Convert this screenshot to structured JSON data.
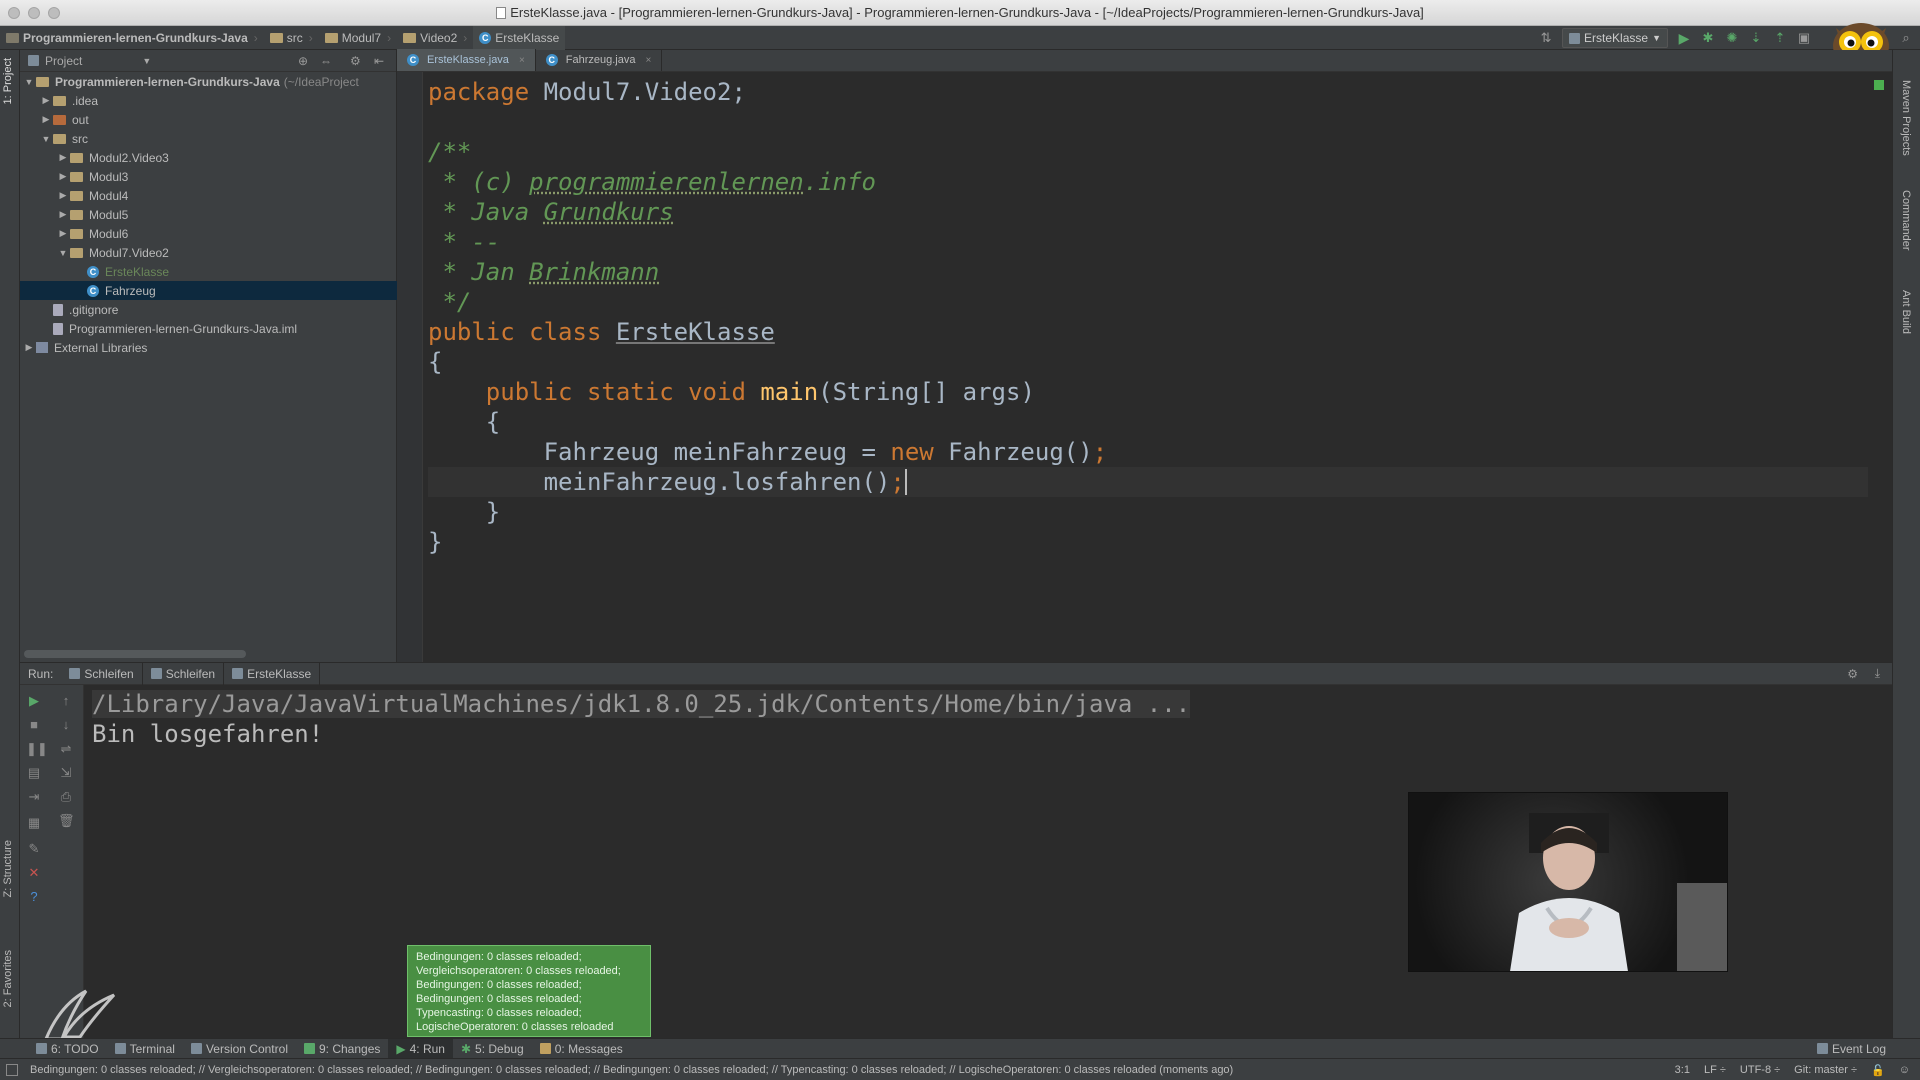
{
  "window": {
    "title": "ErsteKlasse.java - [Programmieren-lernen-Grundkurs-Java] - Programmieren-lernen-Grundkurs-Java - [~/IdeaProjects/Programmieren-lernen-Grundkurs-Java]"
  },
  "navbar": {
    "crumbs": [
      "Programmieren-lernen-Grundkurs-Java",
      "src",
      "Modul7",
      "Video2",
      "ErsteKlasse"
    ],
    "run_config": "ErsteKlasse"
  },
  "left_strip": {
    "project_tab": "1: Project",
    "structure_tab": "Z: Structure",
    "favorites_tab": "2: Favorites"
  },
  "right_strip": {
    "maven_tab": "Maven Projects",
    "commander_tab": "Commander",
    "ant_tab": "Ant Build"
  },
  "project": {
    "header": "Project",
    "tree": [
      {
        "label": "Programmieren-lernen-Grundkurs-Java",
        "suffix": "(~/IdeaProject",
        "level": 0,
        "arrow": "▼",
        "icon": "folder",
        "bold": true
      },
      {
        "label": ".idea",
        "level": 1,
        "arrow": "▶",
        "icon": "folder"
      },
      {
        "label": "out",
        "level": 1,
        "arrow": "▶",
        "icon": "folder-red"
      },
      {
        "label": "src",
        "level": 1,
        "arrow": "▼",
        "icon": "folder"
      },
      {
        "label": "Modul2.Video3",
        "level": 2,
        "arrow": "▶",
        "icon": "folder"
      },
      {
        "label": "Modul3",
        "level": 2,
        "arrow": "▶",
        "icon": "folder"
      },
      {
        "label": "Modul4",
        "level": 2,
        "arrow": "▶",
        "icon": "folder"
      },
      {
        "label": "Modul5",
        "level": 2,
        "arrow": "▶",
        "icon": "folder"
      },
      {
        "label": "Modul6",
        "level": 2,
        "arrow": "▶",
        "icon": "folder"
      },
      {
        "label": "Modul7.Video2",
        "level": 2,
        "arrow": "▼",
        "icon": "folder"
      },
      {
        "label": "ErsteKlasse",
        "level": 3,
        "arrow": "",
        "icon": "class",
        "green": true
      },
      {
        "label": "Fahrzeug",
        "level": 3,
        "arrow": "",
        "icon": "class",
        "selected": true
      },
      {
        "label": ".gitignore",
        "level": 1,
        "arrow": "",
        "icon": "file"
      },
      {
        "label": "Programmieren-lernen-Grundkurs-Java.iml",
        "level": 1,
        "arrow": "",
        "icon": "file"
      },
      {
        "label": "External Libraries",
        "level": 0,
        "arrow": "▶",
        "icon": "library"
      }
    ]
  },
  "editor": {
    "tabs": [
      {
        "label": "ErsteKlasse.java",
        "active": true
      },
      {
        "label": "Fahrzeug.java",
        "active": false
      }
    ],
    "code": {
      "l1": {
        "kw": "package",
        "rest": " Modul7.Video2;"
      },
      "l3": "/**",
      "l4": {
        "pre": " * (c) ",
        "link": "programmierenlernen",
        "post": ".info"
      },
      "l5": {
        "pre": " * Java ",
        "u": "Grundkurs"
      },
      "l6": " * --",
      "l7": {
        "pre": " * Jan ",
        "u": "Brinkmann"
      },
      "l8": " */",
      "l9": {
        "kw1": "public",
        "kw2": "class",
        "name": "ErsteKlasse"
      },
      "l10": "{",
      "l11": {
        "kw1": "public",
        "kw2": "static",
        "kw3": "void",
        "fn": "main",
        "rest": "(String[] args)"
      },
      "l12": "{",
      "l13": {
        "a": "Fahrzeug meinFahrzeug = ",
        "kw": "new",
        "b": " Fahrzeug()",
        "semi": ";"
      },
      "l14": {
        "a": "meinFahrzeug.losfahren()",
        "semi": ";"
      },
      "l15": "}",
      "l16": "}"
    }
  },
  "run": {
    "label": "Run:",
    "tabs": [
      "Schleifen",
      "Schleifen",
      "ErsteKlasse"
    ],
    "console": [
      "/Library/Java/JavaVirtualMachines/jdk1.8.0_25.jdk/Contents/Home/bin/java ...",
      "Bin losgefahren!"
    ]
  },
  "notification": {
    "lines": [
      "Bedingungen: 0 classes reloaded;",
      "Vergleichsoperatoren: 0 classes reloaded;",
      "Bedingungen: 0 classes reloaded;",
      "Bedingungen: 0 classes reloaded;",
      "Typencasting: 0 classes reloaded;",
      "LogischeOperatoren: 0 classes reloaded"
    ]
  },
  "bottom_tabs": [
    {
      "label": "6: TODO"
    },
    {
      "label": "Terminal"
    },
    {
      "label": "Version Control"
    },
    {
      "label": "9: Changes"
    },
    {
      "label": "4: Run",
      "active": true
    },
    {
      "label": "5: Debug"
    },
    {
      "label": "0: Messages"
    }
  ],
  "event_log": "Event Log",
  "status": {
    "message": "Bedingungen: 0 classes reloaded; // Vergleichsoperatoren: 0 classes reloaded; // Bedingungen: 0 classes reloaded; // Bedingungen: 0 classes reloaded; // Typencasting: 0 classes reloaded; // LogischeOperatoren: 0 classes reloaded (moments ago)",
    "position": "3:1",
    "line_sep": "LF ÷",
    "encoding": "UTF-8 ÷",
    "git": "Git: master ÷"
  },
  "colors": {
    "accent": "#3f8fc8",
    "keyword": "#cc7832",
    "comment": "#629755",
    "function": "#ffc66d",
    "notify": "#498f43"
  }
}
